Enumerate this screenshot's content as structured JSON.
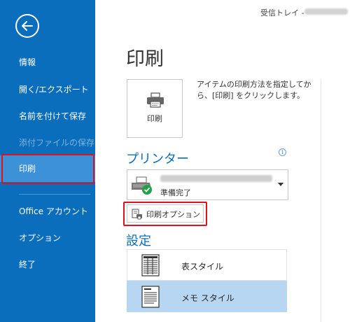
{
  "window": {
    "title": "受信トレイ - "
  },
  "sidebar": {
    "back_icon": "back-arrow-icon",
    "items": [
      {
        "label": "情報",
        "state": "normal"
      },
      {
        "label": "開く/エクスポート",
        "state": "normal"
      },
      {
        "label": "名前を付けて保存",
        "state": "normal"
      },
      {
        "label": "添付ファイルの保存",
        "state": "disabled"
      },
      {
        "label": "印刷",
        "state": "active"
      },
      {
        "label": "Office アカウント",
        "state": "normal"
      },
      {
        "label": "オプション",
        "state": "normal"
      },
      {
        "label": "終了",
        "state": "normal"
      }
    ]
  },
  "main": {
    "title": "印刷",
    "print_button": {
      "label": "印刷",
      "icon": "printer-icon"
    },
    "print_description": "アイテムの印刷方法を指定してから、[印刷] をクリックします。",
    "printer_section": {
      "heading": "プリンター",
      "info_icon": "info-icon",
      "selected_printer": {
        "status": "準備完了",
        "icon": "printer-ready-icon"
      },
      "options_button": {
        "label": "印刷オプション",
        "icon": "print-options-icon"
      }
    },
    "settings_section": {
      "heading": "設定",
      "styles": [
        {
          "label": "表スタイル",
          "icon": "table-style-icon",
          "selected": false
        },
        {
          "label": "メモ スタイル",
          "icon": "memo-style-icon",
          "selected": true
        }
      ]
    }
  },
  "colors": {
    "sidebar_bg": "#0a6ebd",
    "sidebar_active": "#3d91d6",
    "accent_text": "#0a6ebd",
    "highlight_box": "#e0101f",
    "selected_row": "#b6d6f2"
  }
}
